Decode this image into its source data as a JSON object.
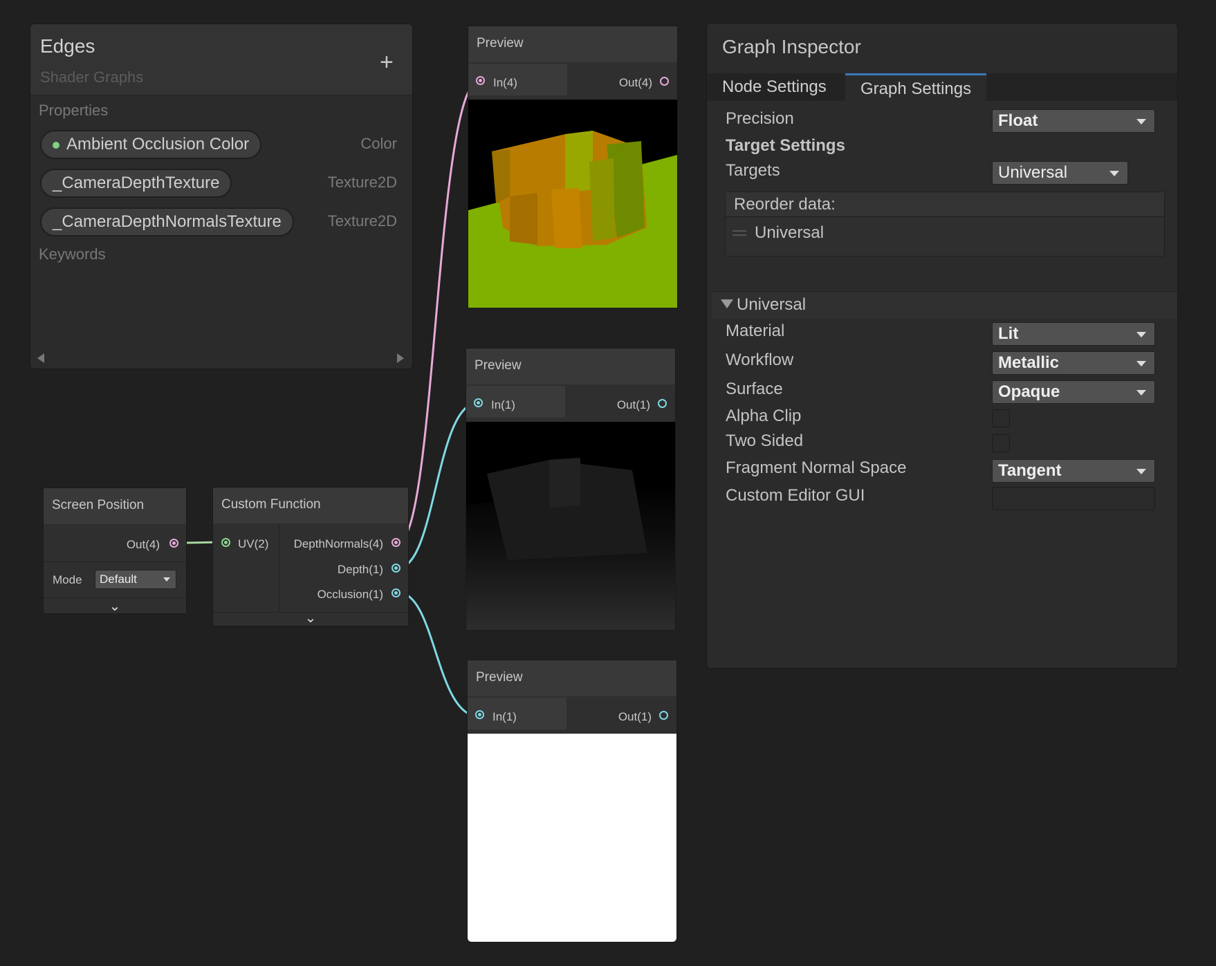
{
  "blackboard": {
    "title": "Edges",
    "subtitle": "Shader Graphs",
    "add_label": "+",
    "properties_header": "Properties",
    "keywords_header": "Keywords",
    "properties": [
      {
        "name": "Ambient Occlusion Color",
        "type": "Color",
        "exposed": true
      },
      {
        "name": "_CameraDepthTexture",
        "type": "Texture2D",
        "exposed": false
      },
      {
        "name": "_CameraDepthNormalsTexture",
        "type": "Texture2D",
        "exposed": false
      }
    ]
  },
  "nodes": {
    "screen_position": {
      "title": "Screen Position",
      "out": "Out(4)",
      "mode_label": "Mode",
      "mode_value": "Default"
    },
    "custom_function": {
      "title": "Custom Function",
      "in": "UV(2)",
      "outputs": [
        "DepthNormals(4)",
        "Depth(1)",
        "Occlusion(1)"
      ]
    },
    "previews": [
      {
        "title": "Preview",
        "in": "In(4)",
        "out": "Out(4)"
      },
      {
        "title": "Preview",
        "in": "In(1)",
        "out": "Out(1)"
      },
      {
        "title": "Preview",
        "in": "In(1)",
        "out": "Out(1)"
      }
    ]
  },
  "inspector": {
    "title": "Graph Inspector",
    "tabs": [
      "Node Settings",
      "Graph Settings"
    ],
    "precision_label": "Precision",
    "precision_value": "Float",
    "target_settings": "Target Settings",
    "targets_label": "Targets",
    "targets_value": "Universal",
    "reorder_label": "Reorder data:",
    "reorder_item": "Universal",
    "universal_header": "Universal",
    "fields": [
      {
        "label": "Material",
        "value": "Lit"
      },
      {
        "label": "Workflow",
        "value": "Metallic"
      },
      {
        "label": "Surface",
        "value": "Opaque"
      },
      {
        "label": "Alpha Clip",
        "value": ""
      },
      {
        "label": "Two Sided",
        "value": ""
      },
      {
        "label": "Fragment Normal Space",
        "value": "Tangent"
      },
      {
        "label": "Custom Editor GUI",
        "value": ""
      }
    ]
  },
  "colors": {
    "background": "#202020",
    "panel": "#2b2b2b",
    "wire_pink": "#e7a9d8",
    "wire_cyan": "#7fd9e3",
    "wire_green": "#a8d8a0",
    "tab_accent": "#3a79bb",
    "ground": "#80b000",
    "block": "#b87c00"
  }
}
